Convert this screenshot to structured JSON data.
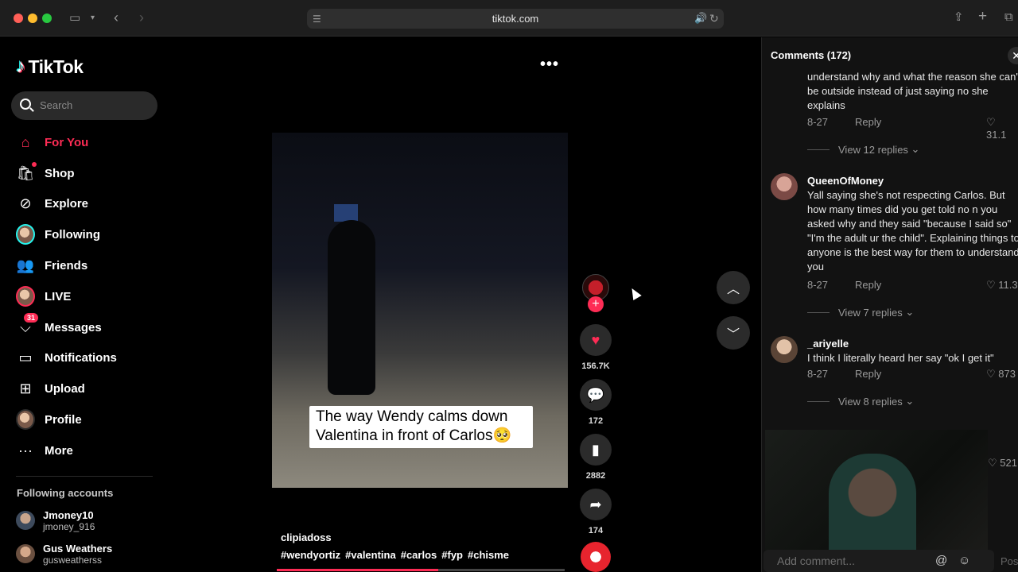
{
  "browser": {
    "url": "tiktok.com"
  },
  "sidebar": {
    "logo": "TikTok",
    "search_placeholder": "Search",
    "items": [
      {
        "label": "For You",
        "icon": "home-icon",
        "active": true
      },
      {
        "label": "Shop",
        "icon": "shop-icon"
      },
      {
        "label": "Explore",
        "icon": "compass-icon"
      },
      {
        "label": "Following",
        "icon": "following-avatar"
      },
      {
        "label": "Friends",
        "icon": "friends-icon"
      },
      {
        "label": "LIVE",
        "icon": "live-avatar"
      },
      {
        "label": "Messages",
        "icon": "messages-icon",
        "badge": "31"
      },
      {
        "label": "Notifications",
        "icon": "notifications-icon"
      },
      {
        "label": "Upload",
        "icon": "upload-icon"
      },
      {
        "label": "Profile",
        "icon": "profile-avatar"
      },
      {
        "label": "More",
        "icon": "more-icon"
      }
    ],
    "following_title": "Following accounts",
    "following_accounts": [
      {
        "name": "Jmoney10",
        "handle": "jmoney_916"
      },
      {
        "name": "Gus Weathers",
        "handle": "gusweatherss"
      }
    ]
  },
  "video": {
    "caption": "The way Wendy calms down Valentina in front of Carlos🥺",
    "author": "clipiadoss",
    "hashtags": [
      "#wendyortiz",
      "#valentina",
      "#carlos",
      "#fyp",
      "#chisme"
    ],
    "progress": 0.56,
    "likes": "156.7K",
    "comments": "172",
    "saves": "2882",
    "shares": "174"
  },
  "comments": {
    "header": "Comments (172)",
    "items": [
      {
        "text_tail": "understand why and what the reason she can't be outside instead of just saying no she explains",
        "date": "8-27",
        "reply": "Reply",
        "likes": "31.1",
        "view_replies": "View 12 replies"
      },
      {
        "user": "QueenOfMoney",
        "text": "Yall saying she's not respecting Carlos. But how many times did you get told no n you asked why and they said \"because I said so\" \"I'm the adult ur the child\". Explaining things to anyone is the best way for them to understand you",
        "date": "8-27",
        "reply": "Reply",
        "likes": "11.3",
        "view_replies": "View 7 replies"
      },
      {
        "user": "_ariyelle",
        "text": "I think I literally heard her say \"ok I get it\"",
        "date": "8-27",
        "reply": "Reply",
        "likes": "873",
        "view_replies": "View 8 replies"
      }
    ],
    "hidden_like": "521",
    "add_placeholder": "Add comment...",
    "post": "Pos"
  }
}
